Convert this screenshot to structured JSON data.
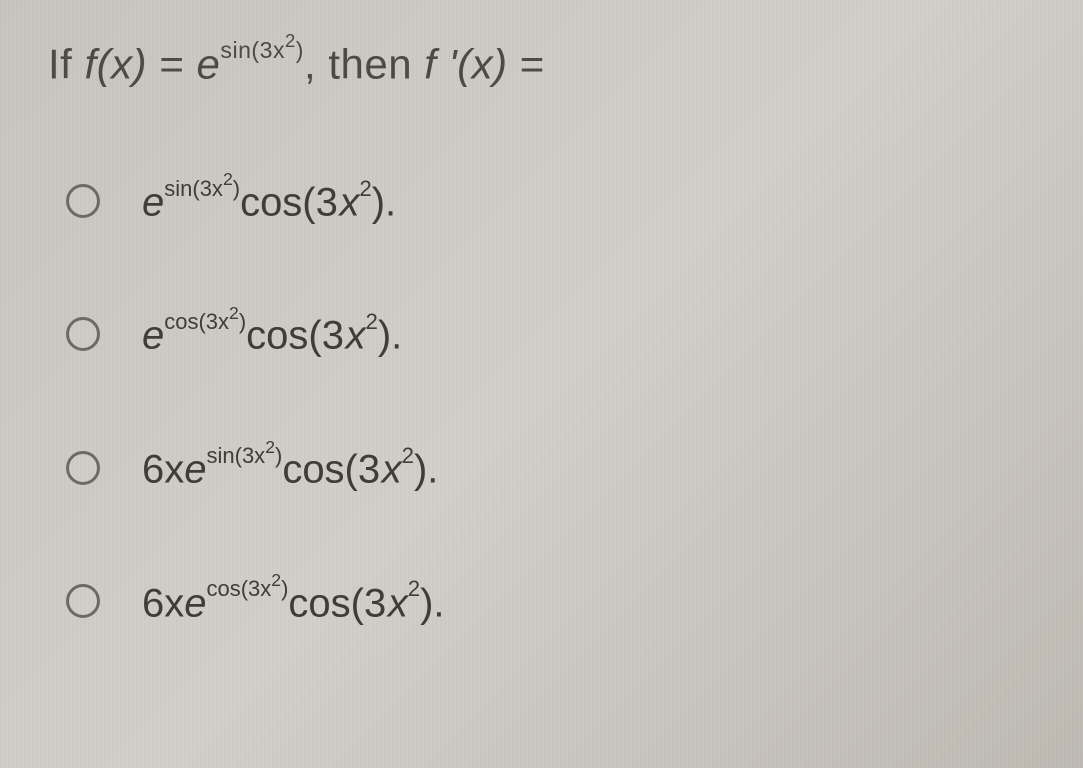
{
  "question": {
    "prefix": "If ",
    "fx": "f(x)",
    "eq1": " = ",
    "e": "e",
    "exp_label": "sin(3x",
    "exp_sq": "2",
    "exp_close": ")",
    "mid": ", then ",
    "fpx": "f '(x)",
    "eq2": " ="
  },
  "options": [
    {
      "lead": "",
      "e": "e",
      "exp": "sin(3x",
      "exp_sq": "2",
      "exp_close": ")",
      "tail_a": "cos(3",
      "tail_x": "x",
      "tail_sq": "2",
      "tail_close": ")."
    },
    {
      "lead": "",
      "e": "e",
      "exp": "cos(3x",
      "exp_sq": "2",
      "exp_close": ")",
      "tail_a": "cos(3",
      "tail_x": "x",
      "tail_sq": "2",
      "tail_close": ")."
    },
    {
      "lead": "6x",
      "e": "e",
      "exp": "sin(3x",
      "exp_sq": "2",
      "exp_close": ")",
      "tail_a": "cos(3",
      "tail_x": "x",
      "tail_sq": "2",
      "tail_close": ")."
    },
    {
      "lead": "6x",
      "e": "e",
      "exp": "cos(3x",
      "exp_sq": "2",
      "exp_close": ")",
      "tail_a": "cos(3",
      "tail_x": "x",
      "tail_sq": "2",
      "tail_close": ")."
    }
  ]
}
